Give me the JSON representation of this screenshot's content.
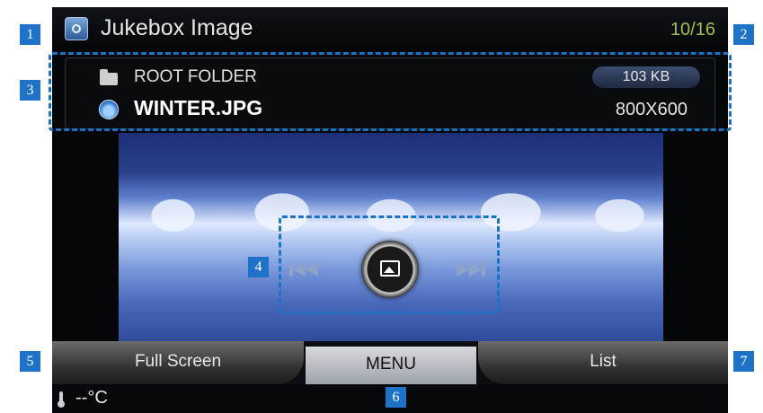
{
  "header": {
    "title": "Jukebox Image",
    "counter": "10/16"
  },
  "file_info": {
    "folder_name": "ROOT FOLDER",
    "file_name": "WINTER.JPG",
    "file_size": "103 KB",
    "resolution": "800X600"
  },
  "bottom_tabs": {
    "left": "Full Screen",
    "center": "MENU",
    "right": "List"
  },
  "status": {
    "temperature": "--°C"
  },
  "markers": [
    "1",
    "2",
    "3",
    "4",
    "5",
    "6",
    "7"
  ],
  "icons": [
    "jukebox-image-icon",
    "folder-icon",
    "image-file-icon",
    "previous-icon",
    "slideshow-icon",
    "next-icon",
    "thermometer-icon"
  ],
  "colors": {
    "callout": "#1b73c6",
    "marker_bg": "#1e73c8",
    "counter": "#9ec04a"
  }
}
